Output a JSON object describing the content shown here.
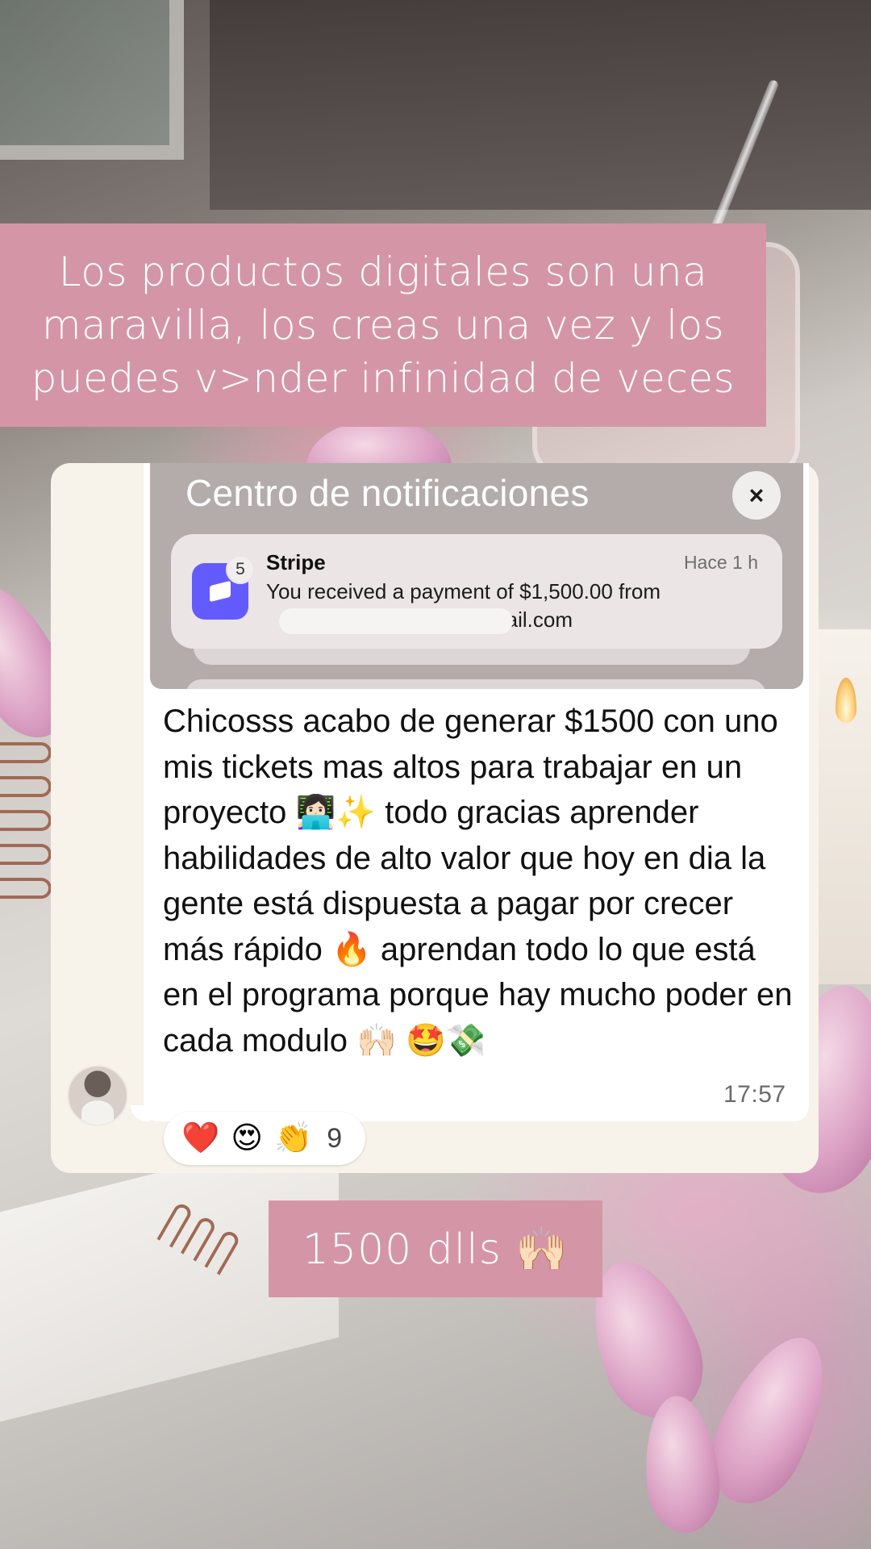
{
  "caption_top": {
    "text": "Los productos digitales son una maravilla, los creas una vez y los puedes v>nder infinidad de veces"
  },
  "notification_center": {
    "title": "Centro de notificaciones",
    "close_icon": "×",
    "notification": {
      "app_name": "Stripe",
      "time": "Hace 1 h",
      "badge_count": "5",
      "body": "You received a payment of $1,500.00 from",
      "email_visible": "ail.com",
      "icon": "stripe-app-icon",
      "brand_color": "#635bff"
    }
  },
  "message": {
    "text": "Chicosss acabo de generar $1500 con uno mis tickets mas altos para trabajar en un proyecto 👩🏻‍💻✨ todo gracias aprender habilidades de alto valor que hoy en dia la gente está dispuesta a pagar por crecer más rápido 🔥 aprendan todo lo que está en el programa porque hay mucho poder en cada modulo 🙌🏻 🤩💸",
    "time": "17:57"
  },
  "reactions": {
    "emojis": [
      "❤️",
      "😍",
      "👏"
    ],
    "count": "9"
  },
  "caption_bottom": {
    "text": "1500 dlls 🙌🏻"
  },
  "colors": {
    "caption_bg": "#d496a6",
    "chat_bg": "#f7f3ea",
    "bubble_bg": "#ffffff",
    "notif_panel_bg": "#b4abab"
  }
}
